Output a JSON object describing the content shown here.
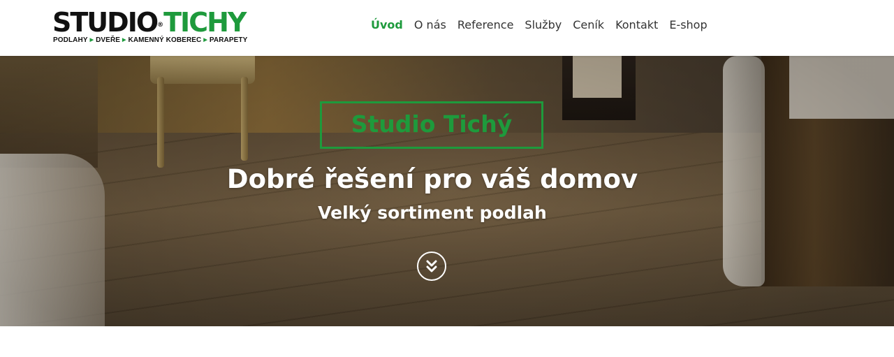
{
  "logo": {
    "studio": "STUDIO",
    "registered": "®",
    "tichy": "TICHY",
    "tagline": [
      "PODLAHY",
      "DVEŘE",
      "KAMENNÝ KOBEREC",
      "PARAPETY"
    ]
  },
  "nav": {
    "items": [
      {
        "label": "Úvod",
        "active": true
      },
      {
        "label": "O nás",
        "active": false
      },
      {
        "label": "Reference",
        "active": false
      },
      {
        "label": "Služby",
        "active": false
      },
      {
        "label": "Ceník",
        "active": false
      },
      {
        "label": "Kontakt",
        "active": false
      },
      {
        "label": "E-shop",
        "active": false
      }
    ]
  },
  "hero": {
    "brand": "Studio Tichý",
    "title": "Dobré řešení pro váš domov",
    "subtitle": "Velký sortiment podlah",
    "scroll_icon": "double-chevron-down-icon"
  },
  "colors": {
    "brand_green": "#1e9a3c",
    "nav_text": "#333333",
    "hero_text": "#ffffff"
  }
}
